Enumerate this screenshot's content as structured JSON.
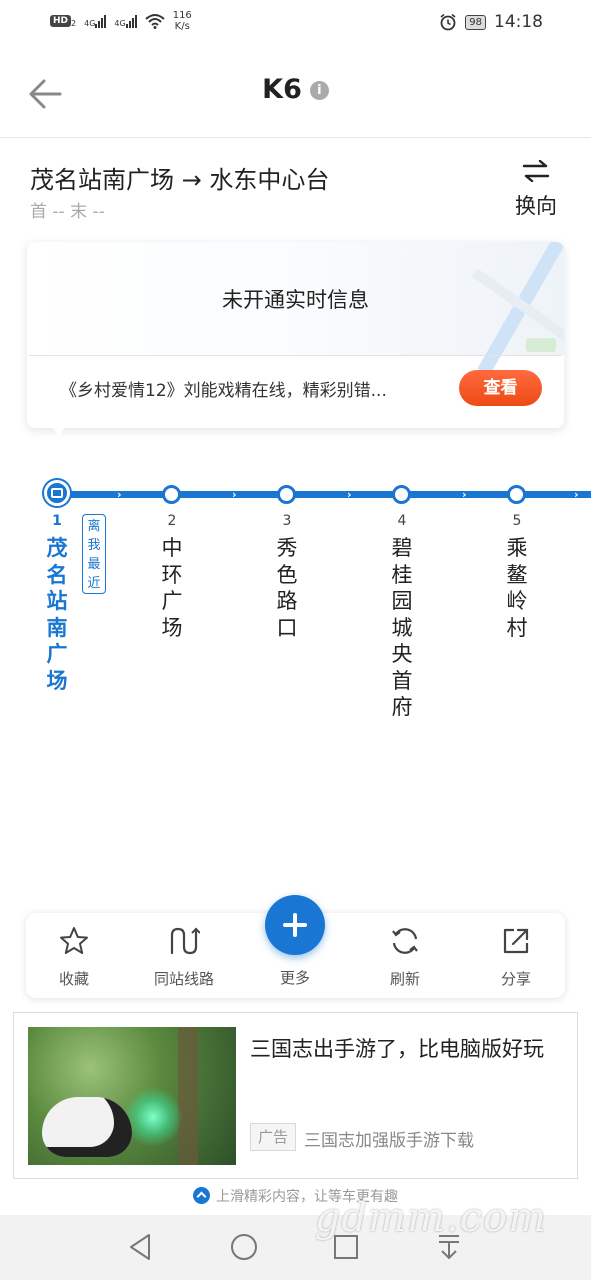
{
  "status_bar": {
    "hd": "HD",
    "hd_sub": "2",
    "net_a": "4G",
    "net_b": "4G",
    "speed_value": "116",
    "speed_unit": "K/s",
    "battery": "98",
    "time": "14:18"
  },
  "header": {
    "title": "K6",
    "info_glyph": "i"
  },
  "route": {
    "name": "茂名站南广场 → 水东中心台",
    "sub": "首 -- 末 --",
    "swap_label": "换向"
  },
  "realtime_card": {
    "message": "未开通实时信息",
    "ad_text": "《乡村爱情12》刘能戏精在线，精彩别错...",
    "button_label": "查看"
  },
  "stops": [
    {
      "num": "1",
      "name": "茂名站南广场",
      "badge": "离我最近"
    },
    {
      "num": "2",
      "name": "中环广场"
    },
    {
      "num": "3",
      "name": "秀色路口"
    },
    {
      "num": "4",
      "name": "碧桂园城央首府"
    },
    {
      "num": "5",
      "name": "乘鳌岭村"
    }
  ],
  "toolbar": {
    "favorite": "收藏",
    "same_station": "同站线路",
    "more": "更多",
    "refresh": "刷新",
    "share": "分享"
  },
  "ad": {
    "title": "三国志出手游了，比电脑版好玩",
    "tag": "广告",
    "desc": "三国志加强版手游下载"
  },
  "hint": "上滑精彩内容，让等车更有趣",
  "watermark": "gdmm.com",
  "colors": {
    "accent": "#1976d2",
    "button": "#ee4a16"
  }
}
